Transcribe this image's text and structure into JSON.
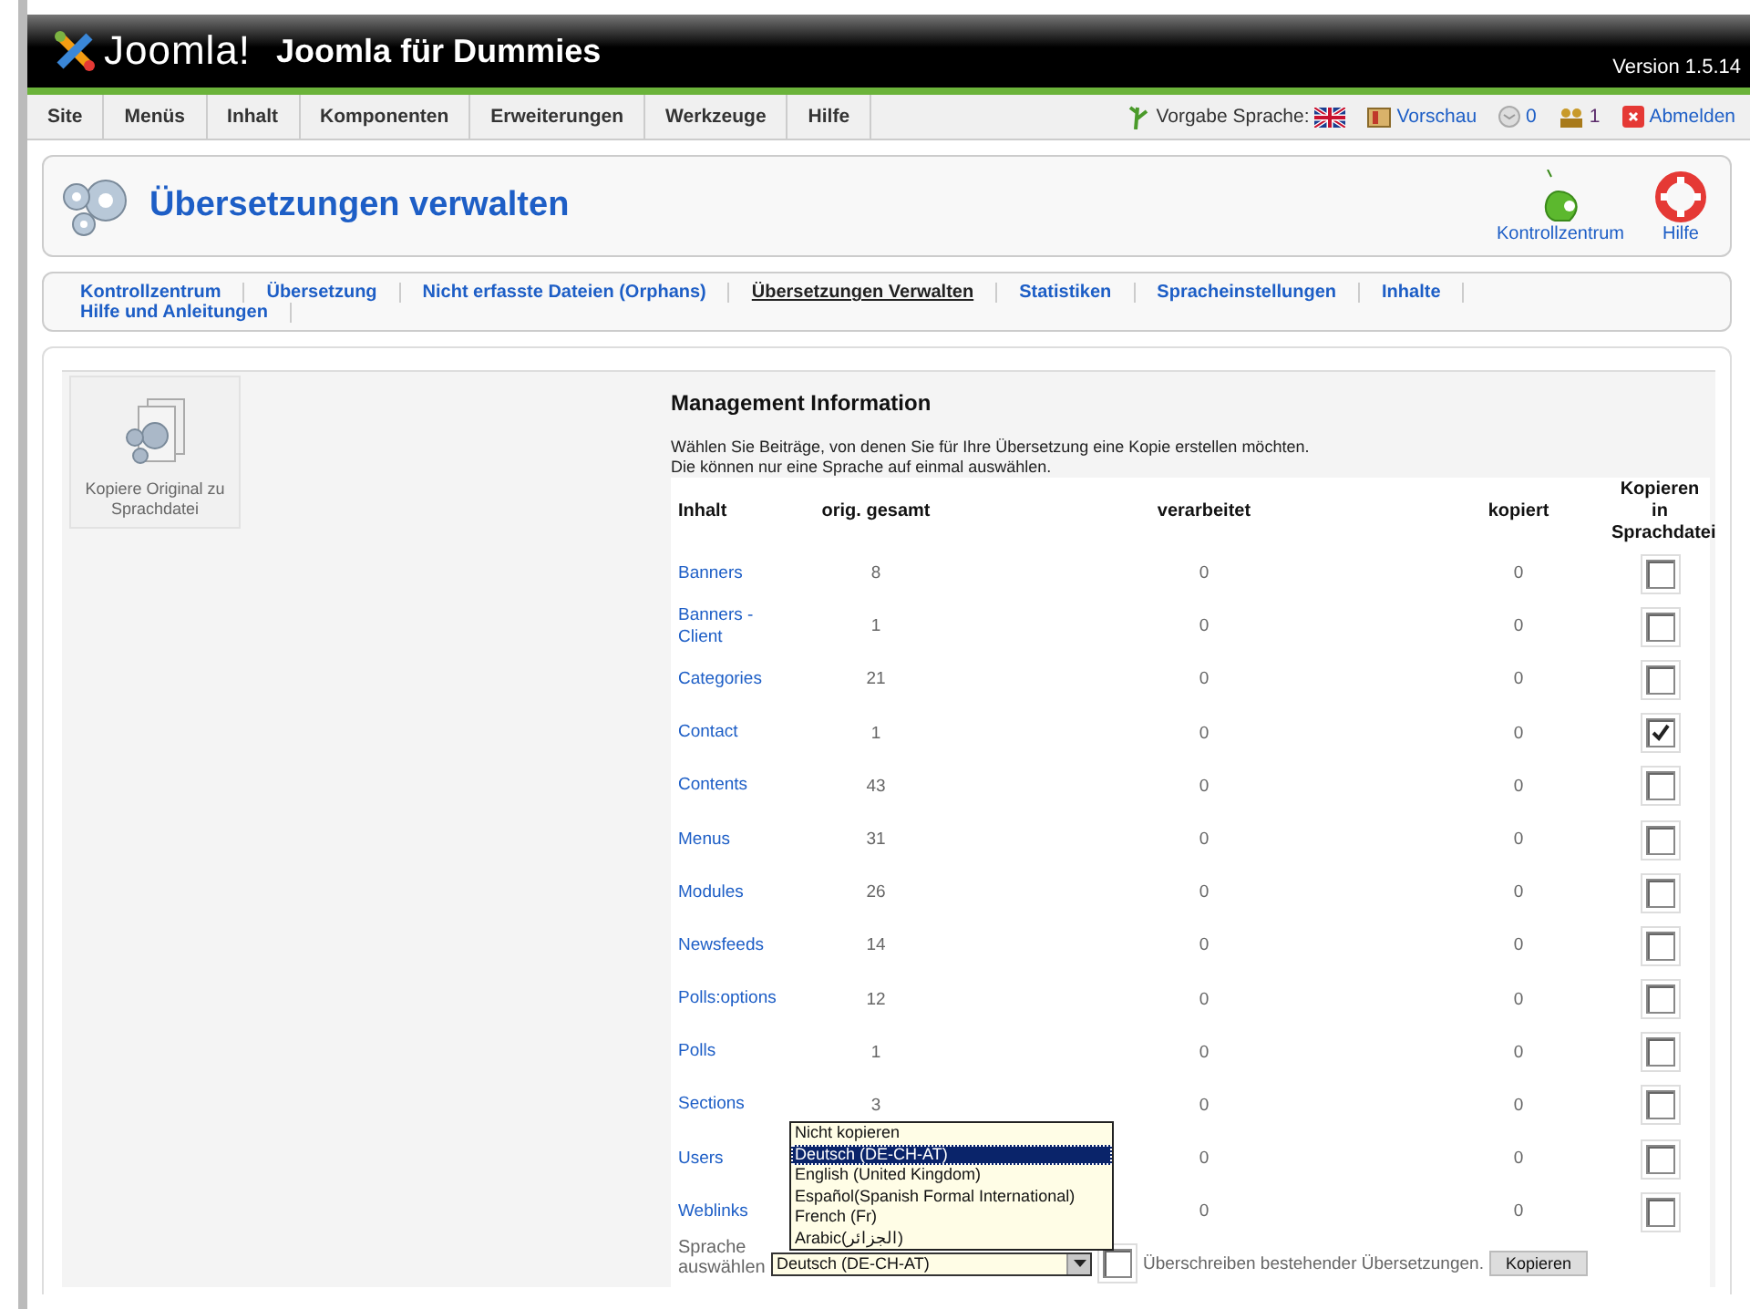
{
  "header": {
    "logo_text": "Joomla!",
    "site_title": "Joomla für Dummies",
    "version": "Version 1.5.14"
  },
  "menu": {
    "items": [
      {
        "label": "Site"
      },
      {
        "label": "Menüs"
      },
      {
        "label": "Inhalt"
      },
      {
        "label": "Komponenten"
      },
      {
        "label": "Erweiterungen"
      },
      {
        "label": "Werkzeuge"
      },
      {
        "label": "Hilfe"
      }
    ],
    "status": {
      "language_label": "Vorgabe Sprache:",
      "preview": "Vorschau",
      "messages": "0",
      "users": "1",
      "logout": "Abmelden"
    }
  },
  "toolbar": {
    "title": "Übersetzungen verwalten",
    "buttons": [
      {
        "label": "Kontrollzentrum",
        "kind": "home"
      },
      {
        "label": "Hilfe",
        "kind": "help"
      }
    ]
  },
  "submenu": {
    "items": [
      {
        "label": "Kontrollzentrum",
        "selected": false
      },
      {
        "label": "Übersetzung",
        "selected": false
      },
      {
        "label": "Nicht erfasste Dateien (Orphans)",
        "selected": false
      },
      {
        "label": "Übersetzungen Verwalten",
        "selected": true
      },
      {
        "label": "Statistiken",
        "selected": false
      },
      {
        "label": "Spracheinstellungen",
        "selected": false
      },
      {
        "label": "Inhalte",
        "selected": false
      },
      {
        "label": "Hilfe und Anleitungen",
        "selected": false
      }
    ]
  },
  "panel": {
    "action": {
      "label": "Kopiere Original zu Sprachdatei"
    },
    "heading": "Management Information",
    "description": [
      "Wählen Sie Beiträge, von denen Sie für Ihre Übersetzung eine Kopie erstellen möchten.",
      "Die können nur eine Sprache auf einmal auswählen."
    ],
    "table": {
      "columns": [
        "Inhalt",
        "orig. gesamt",
        "verarbeitet",
        "kopiert",
        "Kopieren in Sprachdatei"
      ],
      "rows": [
        {
          "name": "Banners",
          "orig": "8",
          "processed": "0",
          "copied": "0",
          "checked": false
        },
        {
          "name": "Banners - Client",
          "orig": "1",
          "processed": "0",
          "copied": "0",
          "checked": false
        },
        {
          "name": "Categories",
          "orig": "21",
          "processed": "0",
          "copied": "0",
          "checked": false
        },
        {
          "name": "Contact",
          "orig": "1",
          "processed": "0",
          "copied": "0",
          "checked": true
        },
        {
          "name": "Contents",
          "orig": "43",
          "processed": "0",
          "copied": "0",
          "checked": false
        },
        {
          "name": "Menus",
          "orig": "31",
          "processed": "0",
          "copied": "0",
          "checked": false
        },
        {
          "name": "Modules",
          "orig": "26",
          "processed": "0",
          "copied": "0",
          "checked": false
        },
        {
          "name": "Newsfeeds",
          "orig": "14",
          "processed": "0",
          "copied": "0",
          "checked": false
        },
        {
          "name": "Polls:options",
          "orig": "12",
          "processed": "0",
          "copied": "0",
          "checked": false
        },
        {
          "name": "Polls",
          "orig": "1",
          "processed": "0",
          "copied": "0",
          "checked": false
        },
        {
          "name": "Sections",
          "orig": "3",
          "processed": "0",
          "copied": "0",
          "checked": false
        },
        {
          "name": "Users",
          "processed": "0",
          "copied": "0",
          "checked": false
        },
        {
          "name": "Weblinks",
          "processed": "0",
          "copied": "0",
          "checked": false
        }
      ]
    },
    "language": {
      "label": "Sprache auswählen",
      "value": "Deutsch (DE-CH-AT)",
      "expanded": true,
      "options": [
        {
          "label": "Nicht kopieren",
          "selected": false
        },
        {
          "label": "Deutsch (DE-CH-AT)",
          "selected": true
        },
        {
          "label": "English (United Kingdom)",
          "selected": false
        },
        {
          "label": "Español(Spanish Formal International)",
          "selected": false
        },
        {
          "label": "French (Fr)",
          "selected": false
        },
        {
          "label": "Arabic(الجزائر)",
          "selected": false
        }
      ]
    },
    "overwrite": {
      "label": "Überschreiben bestehender Übersetzungen.",
      "checked": false
    },
    "submit": "Kopieren"
  }
}
